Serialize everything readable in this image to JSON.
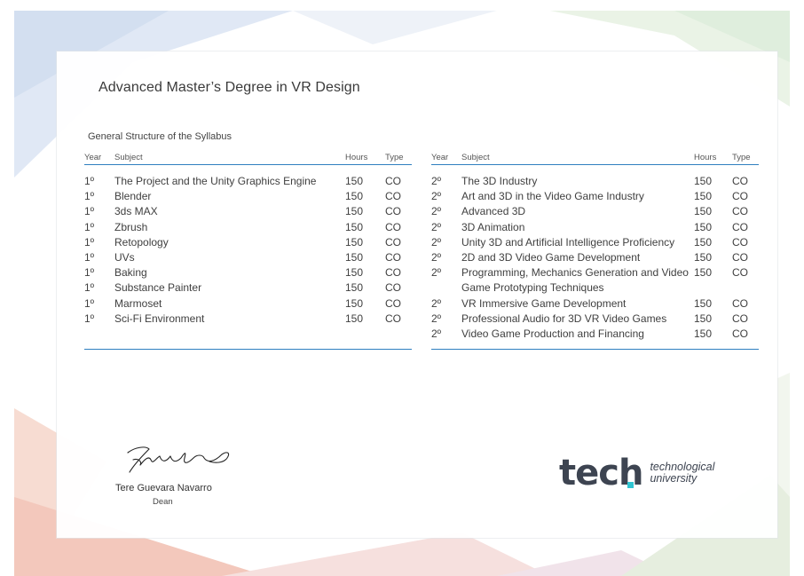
{
  "certificate": {
    "title": "Advanced Master’s Degree in VR Design",
    "section_heading": "General Structure of the Syllabus"
  },
  "table_left": {
    "headers": [
      "Year",
      "Subject",
      "Hours",
      "Type"
    ],
    "rows": [
      {
        "year": "1º",
        "subject": "The Project and the Unity Graphics Engine",
        "hours": "150",
        "type": "CO"
      },
      {
        "year": "1º",
        "subject": "Blender",
        "hours": "150",
        "type": "CO"
      },
      {
        "year": "1º",
        "subject": "3ds MAX",
        "hours": "150",
        "type": "CO"
      },
      {
        "year": "1º",
        "subject": "Zbrush",
        "hours": "150",
        "type": "CO"
      },
      {
        "year": "1º",
        "subject": "Retopology",
        "hours": "150",
        "type": "CO"
      },
      {
        "year": "1º",
        "subject": "UVs",
        "hours": "150",
        "type": "CO"
      },
      {
        "year": "1º",
        "subject": "Baking",
        "hours": "150",
        "type": "CO"
      },
      {
        "year": "1º",
        "subject": "Substance Painter",
        "hours": "150",
        "type": "CO"
      },
      {
        "year": "1º",
        "subject": "Marmoset",
        "hours": "150",
        "type": "CO"
      },
      {
        "year": "1º",
        "subject": "Sci-Fi Environment",
        "hours": "150",
        "type": "CO"
      }
    ]
  },
  "table_right": {
    "headers": [
      "Year",
      "Subject",
      "Hours",
      "Type"
    ],
    "rows": [
      {
        "year": "2º",
        "subject": "The 3D Industry",
        "hours": "150",
        "type": "CO"
      },
      {
        "year": "2º",
        "subject": "Art and 3D in the Video Game Industry",
        "hours": "150",
        "type": "CO"
      },
      {
        "year": "2º",
        "subject": "Advanced 3D",
        "hours": "150",
        "type": "CO"
      },
      {
        "year": "2º",
        "subject": "3D Animation",
        "hours": "150",
        "type": "CO"
      },
      {
        "year": "2º",
        "subject": "Unity 3D and Artificial Intelligence Proficiency",
        "hours": "150",
        "type": "CO"
      },
      {
        "year": "2º",
        "subject": "2D and 3D Video Game Development",
        "hours": "150",
        "type": "CO"
      },
      {
        "year": "2º",
        "subject": "Programming, Mechanics Generation and Video Game Prototyping Techniques",
        "hours": "150",
        "type": "CO"
      },
      {
        "year": "2º",
        "subject": "VR Immersive Game Development",
        "hours": "150",
        "type": "CO"
      },
      {
        "year": "2º",
        "subject": "Professional Audio for 3D VR Video Games",
        "hours": "150",
        "type": "CO"
      },
      {
        "year": "2º",
        "subject": "Video Game Production and Financing",
        "hours": "150",
        "type": "CO"
      }
    ]
  },
  "signatory": {
    "name": "Tere Guevara Navarro",
    "role": "Dean"
  },
  "logo": {
    "word": "tech",
    "line1": "technological",
    "line2": "university",
    "accent_color": "#30c5d2",
    "text_color": "#3d4451"
  },
  "colors": {
    "rule_blue": "#2f7fc0"
  }
}
